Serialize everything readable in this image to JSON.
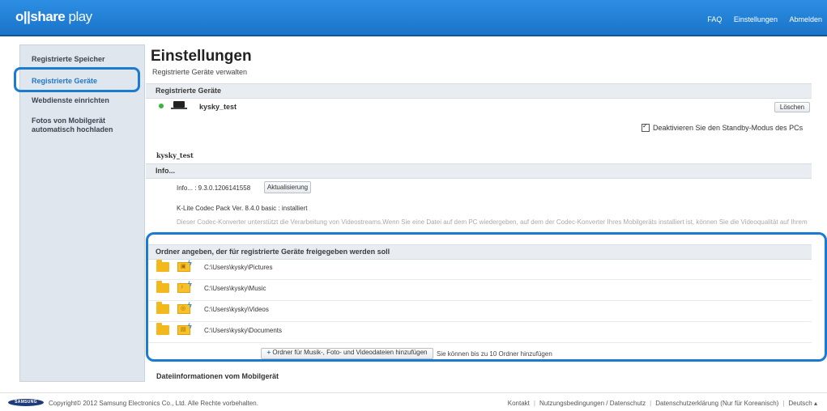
{
  "header": {
    "logo_part1": "o|",
    "logo_part2": "|share",
    "logo_part3": " play",
    "nav": [
      "FAQ",
      "Einstellungen",
      "Abmelden"
    ]
  },
  "sidebar": {
    "items": [
      {
        "label": "Registrierte Speicher"
      },
      {
        "label": "Registrierte Geräte"
      },
      {
        "label": "Webdienste einrichten"
      },
      {
        "label_line1": "Fotos von Mobilgerät",
        "label_line2": "automatisch hochladen"
      }
    ]
  },
  "main": {
    "title": "Einstellungen",
    "subtitle": "Registrierte Geräte verwalten",
    "registered_section": "Registrierte Geräte",
    "device_name": "kysky_test",
    "delete_button": "Löschen",
    "standby_label": "Deaktivieren Sie den Standby-Modus des PCs",
    "device_name_heading": "kysky_test",
    "info_section": "Info...",
    "info_version": "Info... : 9.3.0.1206141558",
    "update_button": "Aktualisierung",
    "codec_line": "K-Lite Codec Pack Ver. 8.4.0 basic : installiert",
    "codec_description": "Dieser Codec-Konverter unterstützt die Verarbeitung von Videostreams.Wenn Sie eine Datei auf dem PC wiedergeben, auf dem der Codec-Konverter Ihres Mobilgeräts installiert ist, können Sie die Videoqualität auf Ihrem Mobilgerät genießen.",
    "folders_section": "Ordner angeben, der für registrierte Geräte freigegeben werden soll",
    "folders": [
      {
        "path": "C:\\Users\\kysky\\Pictures",
        "icon": "picture-folder-icon"
      },
      {
        "path": "C:\\Users\\kysky\\Music",
        "icon": "music-folder-icon"
      },
      {
        "path": "C:\\Users\\kysky\\Videos",
        "icon": "video-folder-icon"
      },
      {
        "path": "C:\\Users\\kysky\\Documents",
        "icon": "document-folder-icon"
      }
    ],
    "add_folder_button": "Ordner für Musik-, Foto- und Videodateien hinzufügen",
    "add_folder_note": "Sie können bis zu 10 Ordner hinzufügen",
    "mobile_info_heading": "Dateiinformationen vom Mobilgerät"
  },
  "footer": {
    "samsung_logo": "SAMSUNG",
    "copyright": "Copyright© 2012 Samsung Electronics Co., Ltd. Alle Rechte vorbehalten.",
    "links": [
      "Kontakt",
      "Nutzungsbedingungen / Datenschutz",
      "Datenschutzerklärung (Nur für Koreanisch)",
      "Deutsch"
    ]
  },
  "colors": {
    "header_blue": "#1f7fd6",
    "highlight_blue": "#1a7bd1",
    "sidebar_bg": "#dfe6ee",
    "active_link": "#2277c8",
    "folder_yellow": "#f2b81c"
  }
}
